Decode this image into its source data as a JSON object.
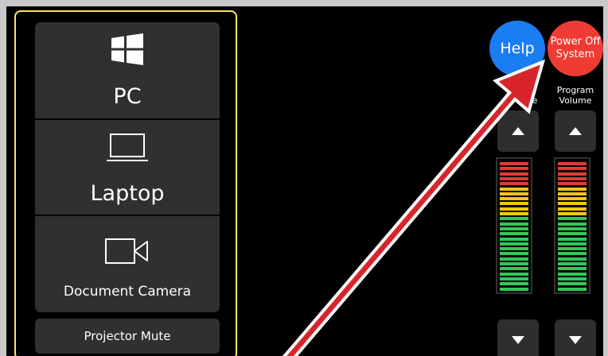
{
  "sources": {
    "pc_label": "PC",
    "laptop_label": "Laptop",
    "doc_camera_label": "Document Camera"
  },
  "projector_mute_label": "Projector Mute",
  "help_label": "Help",
  "power": {
    "line1": "Power Off",
    "line2": "System"
  },
  "volume": {
    "mic_label_fragment": "e",
    "program_line1": "Program",
    "program_line2": "Volume"
  },
  "colors": {
    "help": "#1b7df2",
    "power_off": "#ee3c35",
    "selected_border": "#ffe65a",
    "arrow": "#d8252c"
  }
}
